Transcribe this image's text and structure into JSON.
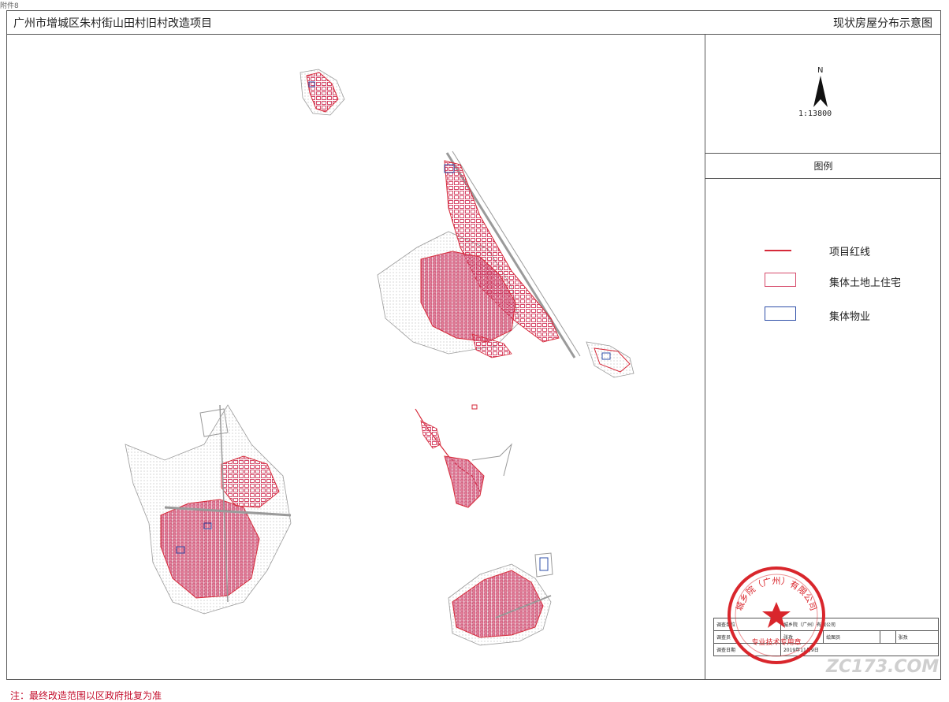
{
  "header": {
    "corner_mark": "附件8",
    "project_title": "广州市增城区朱村街山田村旧村改造项目",
    "sheet_title": "现状房屋分布示意图"
  },
  "north": {
    "letter": "N",
    "scale": "1:13800"
  },
  "legend": {
    "title": "图例",
    "items": [
      {
        "label": "项目红线",
        "symbol": "line",
        "color": "#d62a3a"
      },
      {
        "label": "集体土地上住宅",
        "symbol": "box",
        "color": "#d64a6a"
      },
      {
        "label": "集体物业",
        "symbol": "box",
        "color": "#2f4fa8"
      }
    ]
  },
  "sign_table": {
    "row1": {
      "label": "调查单位",
      "value": "城乡院（广州）有限公司"
    },
    "row2": {
      "c1": "调查员",
      "c2": "张孜",
      "c3": "绘图员",
      "c4": "",
      "c5": "张孜"
    },
    "row3": {
      "label": "调查日期",
      "value": "2019年11月9日"
    }
  },
  "note": "注：最终改造范围以区政府批复为准",
  "seal": {
    "top_text": "城乡院（广州）有限公司",
    "bottom_text": "专业技术专用章"
  },
  "watermark": "ZC173.COM",
  "colors": {
    "house": "#d64a6a",
    "road": "#9a9a9a",
    "redline": "#d62a3a",
    "property": "#2f4fa8",
    "seal": "#d9262c"
  }
}
